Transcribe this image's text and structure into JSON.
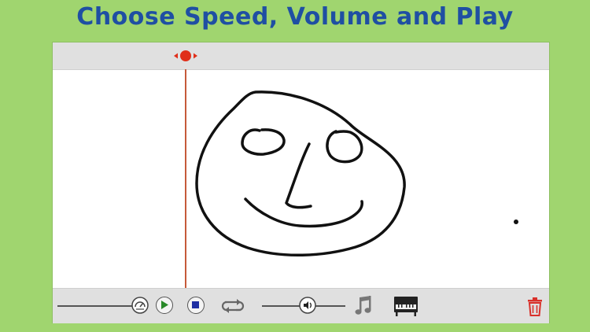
{
  "header": {
    "title": "Choose Speed, Volume and Play"
  },
  "colors": {
    "background": "#a0d56f",
    "title": "#1f4fa3",
    "playhead": "#e02f1a",
    "play_icon": "#2a8a2a",
    "stop_icon": "#1f2fa3",
    "trash_icon": "#d9302a"
  },
  "toolbar": {
    "speed_slider": {
      "icon": "speedometer-icon",
      "value": 0.95
    },
    "play_button": {
      "icon": "play-icon"
    },
    "stop_button": {
      "icon": "stop-icon"
    },
    "loop_button": {
      "icon": "loop-icon"
    },
    "volume_slider": {
      "icon": "speaker-icon",
      "value": 0.55
    },
    "instrument_notes": {
      "icon": "music-notes-icon"
    },
    "instrument_piano": {
      "icon": "piano-icon"
    },
    "clear_button": {
      "icon": "trash-icon"
    }
  }
}
